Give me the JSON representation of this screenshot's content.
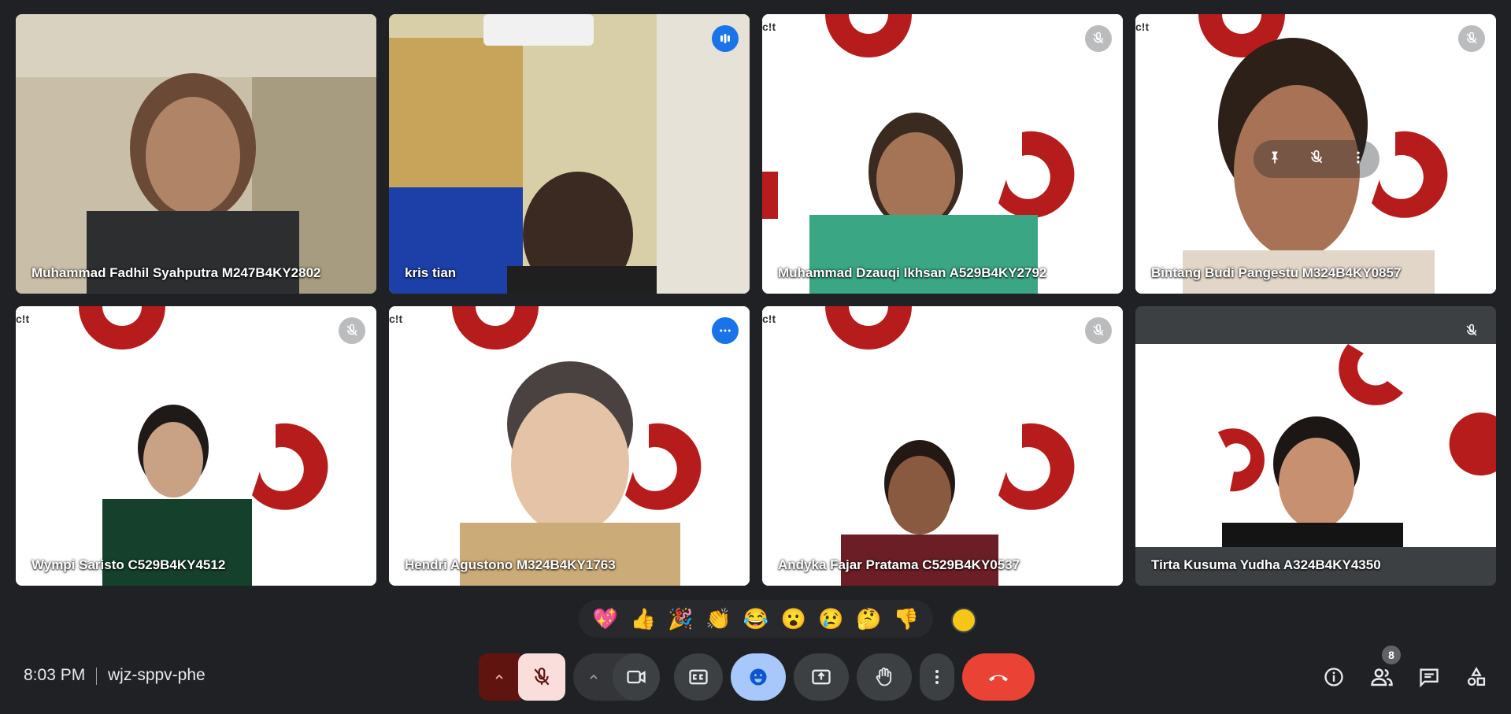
{
  "participants": [
    {
      "name": "Muhammad Fadhil Syahputra M247B4KY2802",
      "status": "none"
    },
    {
      "name": "kris tian",
      "status": "speaking"
    },
    {
      "name": "Muhammad Dzauqi Ikhsan A529B4KY2792",
      "status": "muted"
    },
    {
      "name": "Bintang Budi Pangestu M324B4KY0857",
      "status": "muted"
    },
    {
      "name": "Wympi Saristo C529B4KY4512",
      "status": "muted"
    },
    {
      "name": "Hendri Agustono M324B4KY1763",
      "status": "more"
    },
    {
      "name": "Andyka Fajar Pratama C529B4KY0537",
      "status": "muted"
    },
    {
      "name": "Tirta Kusuma Yudha A324B4KY4350",
      "status": "muted"
    }
  ],
  "reactions": [
    "💖",
    "👍",
    "🎉",
    "👏",
    "😂",
    "😮",
    "😢",
    "🤔",
    "👎"
  ],
  "footer": {
    "time": "8:03 PM",
    "meeting_code": "wjz-sppv-phe",
    "people_count": "8"
  },
  "colors": {
    "background": "#202124",
    "end_call": "#ea4335",
    "active_border": "#8ab4f8",
    "brand_red": "#b71c1c"
  }
}
